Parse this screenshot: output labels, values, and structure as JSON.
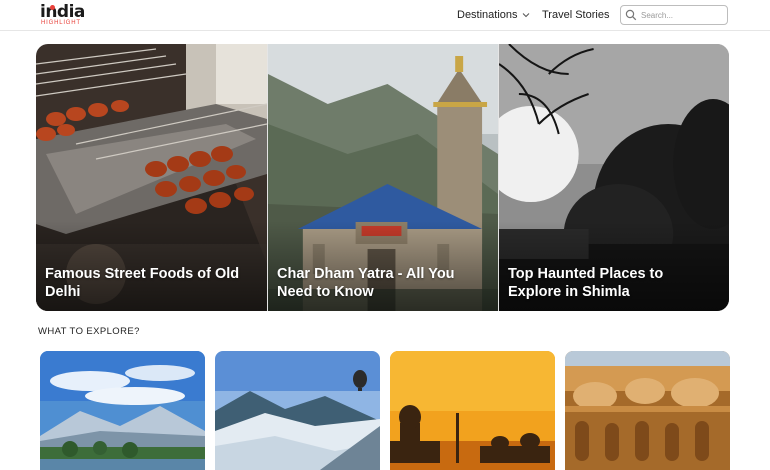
{
  "header": {
    "logo_text": "india",
    "logo_sub": "HIGHLIGHT",
    "nav": {
      "destinations": "Destinations",
      "travel_stories": "Travel Stories"
    },
    "search": {
      "placeholder": "Search..."
    }
  },
  "hero": {
    "cards": [
      {
        "title": "Famous Street Foods of Old Delhi"
      },
      {
        "title": "Char Dham Yatra - All You Need to Know"
      },
      {
        "title": "Top Haunted Places to Explore in Shimla"
      }
    ]
  },
  "explore": {
    "heading": "WHAT TO EXPLORE?",
    "cards": [
      {
        "image": "kashmir-lake-mountains"
      },
      {
        "image": "snowy-valley-hot-air-balloon"
      },
      {
        "image": "taj-mahal-sunset"
      },
      {
        "image": "rajasthan-sandstone-fort"
      }
    ]
  },
  "colors": {
    "brand_red": "#e8413a",
    "text_dark": "#1b1b1b"
  }
}
